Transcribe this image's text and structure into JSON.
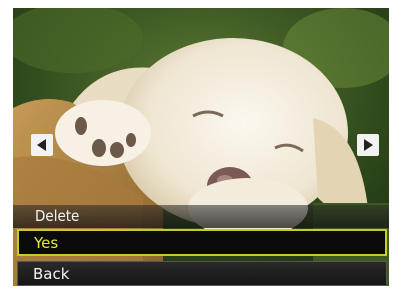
{
  "menu": {
    "title": "Delete",
    "items": [
      {
        "label": "Yes",
        "selected": true
      },
      {
        "label": "Back",
        "selected": false
      }
    ]
  },
  "navigation": {
    "prev_icon": "triangle-left-icon",
    "next_icon": "triangle-right-icon"
  },
  "colors": {
    "highlight_border": "#c8cc28",
    "highlight_text": "#e6ea3a",
    "menu_background": "#0a0a0a"
  }
}
